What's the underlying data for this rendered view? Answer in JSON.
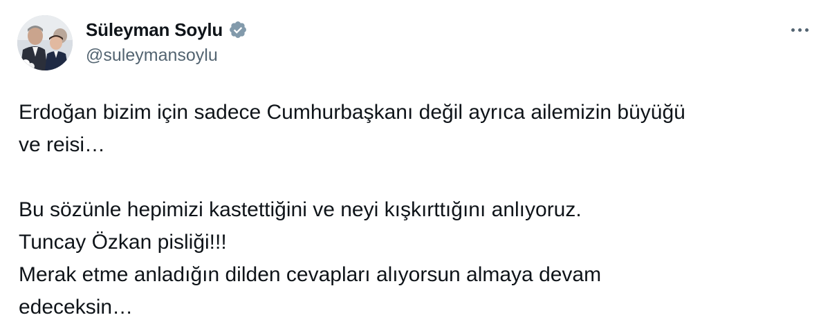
{
  "author": {
    "display_name": "Süleyman Soylu",
    "handle": "@suleymansoylu",
    "verified_icon": "verified-badge-icon",
    "verified_color": "#829aab"
  },
  "menu": {
    "icon": "more-options-icon"
  },
  "tweet": {
    "paragraphs": [
      {
        "lines": [
          "Erdoğan bizim için sadece Cumhurbaşkanı değil ayrıca ailemizin büyüğü",
          "ve reisi…"
        ]
      },
      {
        "lines": [
          "Bu sözünle hepimizi kastettiğini ve neyi kışkırttığını anlıyoruz.",
          "Tuncay Özkan pisliği!!!",
          "Merak etme anladığın dilden cevapları alıyorsun almaya devam",
          "edeceksin…"
        ]
      }
    ]
  },
  "colors": {
    "text_primary": "#0f1419",
    "text_secondary": "#536471",
    "background": "#ffffff"
  }
}
